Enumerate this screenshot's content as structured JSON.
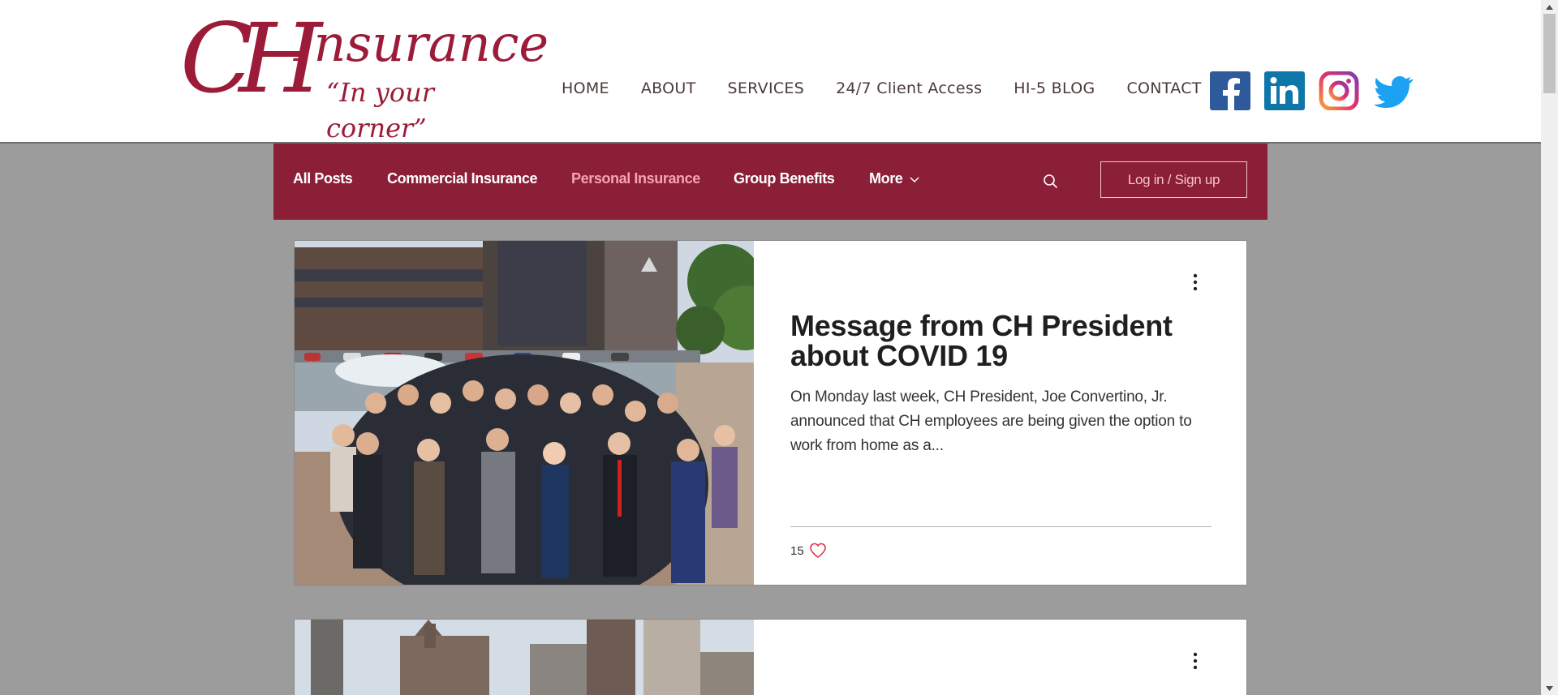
{
  "logo": {
    "mark": "CH",
    "word": "Insurance",
    "tagline": "“In your corner”"
  },
  "nav": {
    "items": [
      {
        "label": "HOME"
      },
      {
        "label": "ABOUT"
      },
      {
        "label": "SERVICES"
      },
      {
        "label": "24/7 Client Access"
      },
      {
        "label": "HI-5 BLOG"
      },
      {
        "label": "CONTACT"
      }
    ]
  },
  "social": {
    "icons": [
      "facebook-icon",
      "linkedin-icon",
      "instagram-icon",
      "twitter-icon"
    ]
  },
  "blog_nav": {
    "categories": [
      {
        "label": "All Posts",
        "active": false
      },
      {
        "label": "Commercial Insurance",
        "active": false
      },
      {
        "label": "Personal Insurance",
        "active": true
      },
      {
        "label": "Group Benefits",
        "active": false
      },
      {
        "label": "More",
        "active": false
      }
    ],
    "login_label": "Log in / Sign up",
    "search_icon": "search-icon"
  },
  "posts": [
    {
      "title": "Message from CH President about COVID 19",
      "excerpt": "On Monday last week, CH President, Joe Convertino, Jr. announced that CH employees are being given the option to work from home as a...",
      "likes": "15"
    },
    {
      "title": "",
      "excerpt": "",
      "likes": ""
    }
  ],
  "colors": {
    "brand": "#8c1f38",
    "active_category": "#f7a3b3",
    "background": "#9c9c9c"
  }
}
